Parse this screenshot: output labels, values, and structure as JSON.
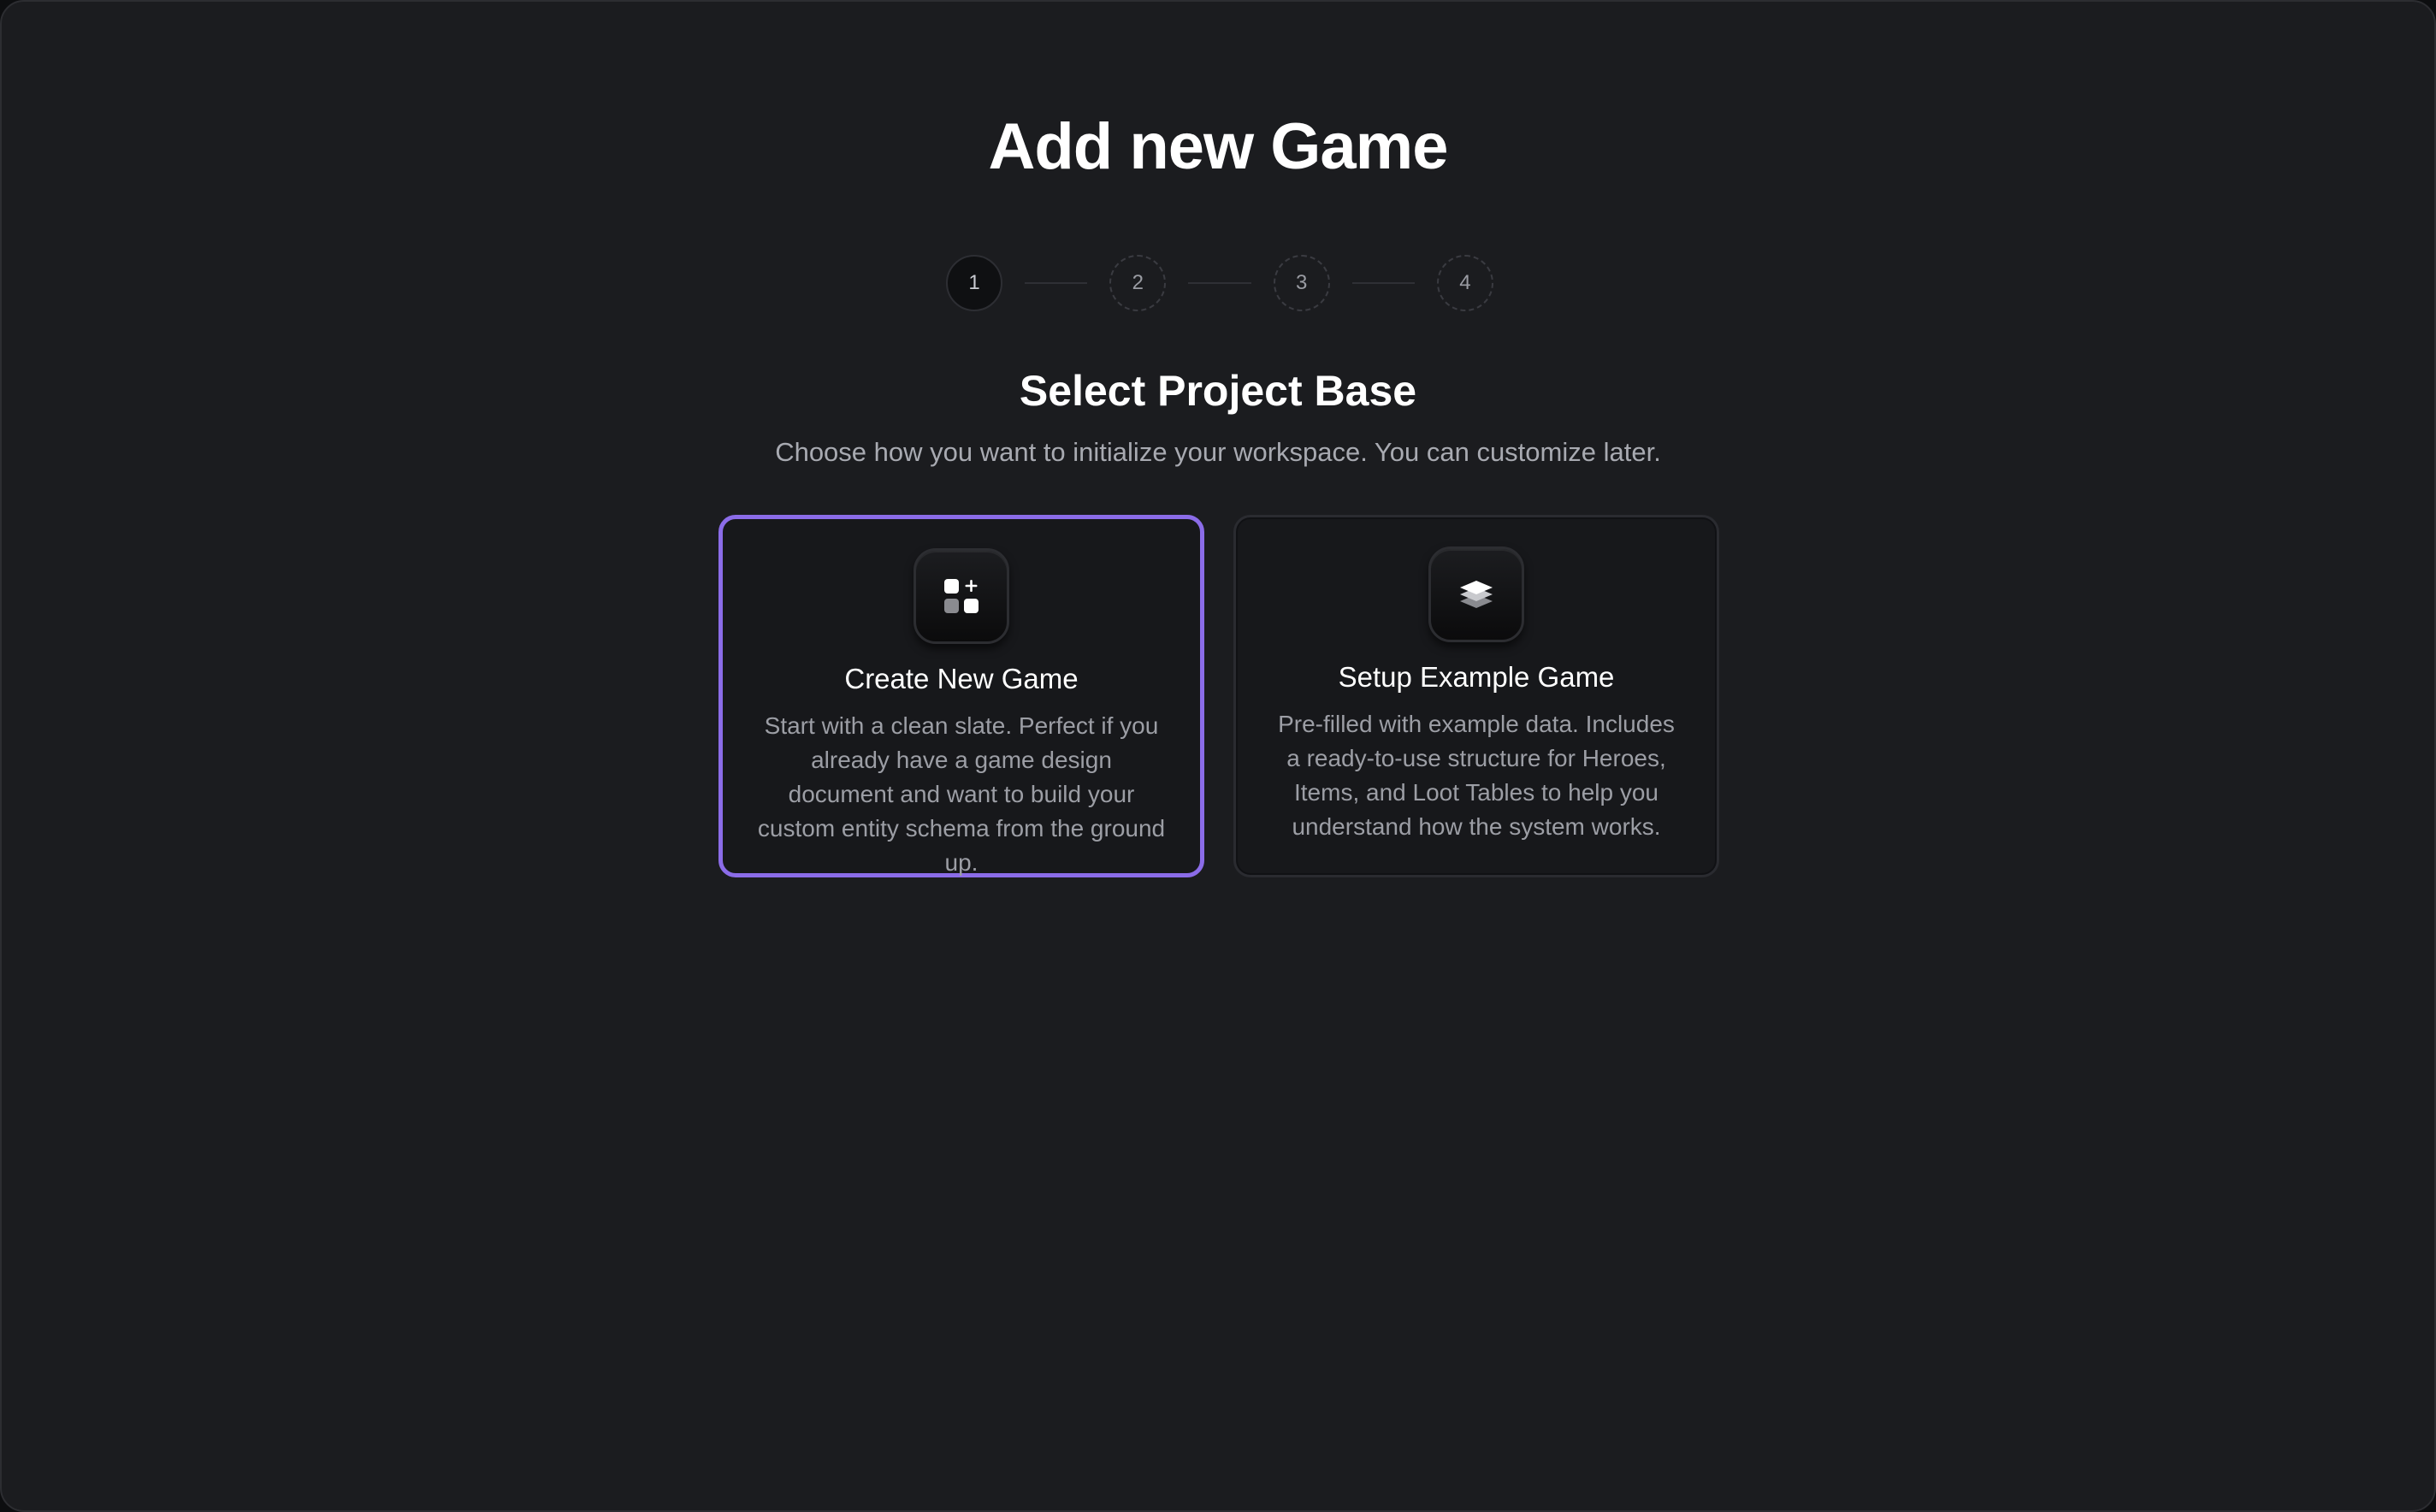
{
  "page": {
    "title": "Add new Game"
  },
  "stepper": {
    "current_step": 1,
    "steps": [
      {
        "label": "1",
        "state": "active"
      },
      {
        "label": "2",
        "state": "pending"
      },
      {
        "label": "3",
        "state": "pending"
      },
      {
        "label": "4",
        "state": "pending"
      }
    ]
  },
  "section": {
    "title": "Select Project Base",
    "subtitle": "Choose how you want to initialize your workspace. You can customize later."
  },
  "options": [
    {
      "title": "Create New Game",
      "description": "Start with a clean slate. Perfect if you already have a game design document and want to build your custom entity schema from the ground up.",
      "icon": "apps-add-icon",
      "selected": true
    },
    {
      "title": "Setup Example Game",
      "description": "Pre-filled with example data. Includes a ready-to-use structure for Heroes, Items, and Loot Tables to help you understand how the system works.",
      "icon": "layers-icon",
      "selected": false
    }
  ],
  "colors": {
    "background": "#1b1c1f",
    "accent": "#8b6ce8",
    "card": "#17181b",
    "text_primary": "#ffffff",
    "text_secondary": "#9c9ea5"
  }
}
